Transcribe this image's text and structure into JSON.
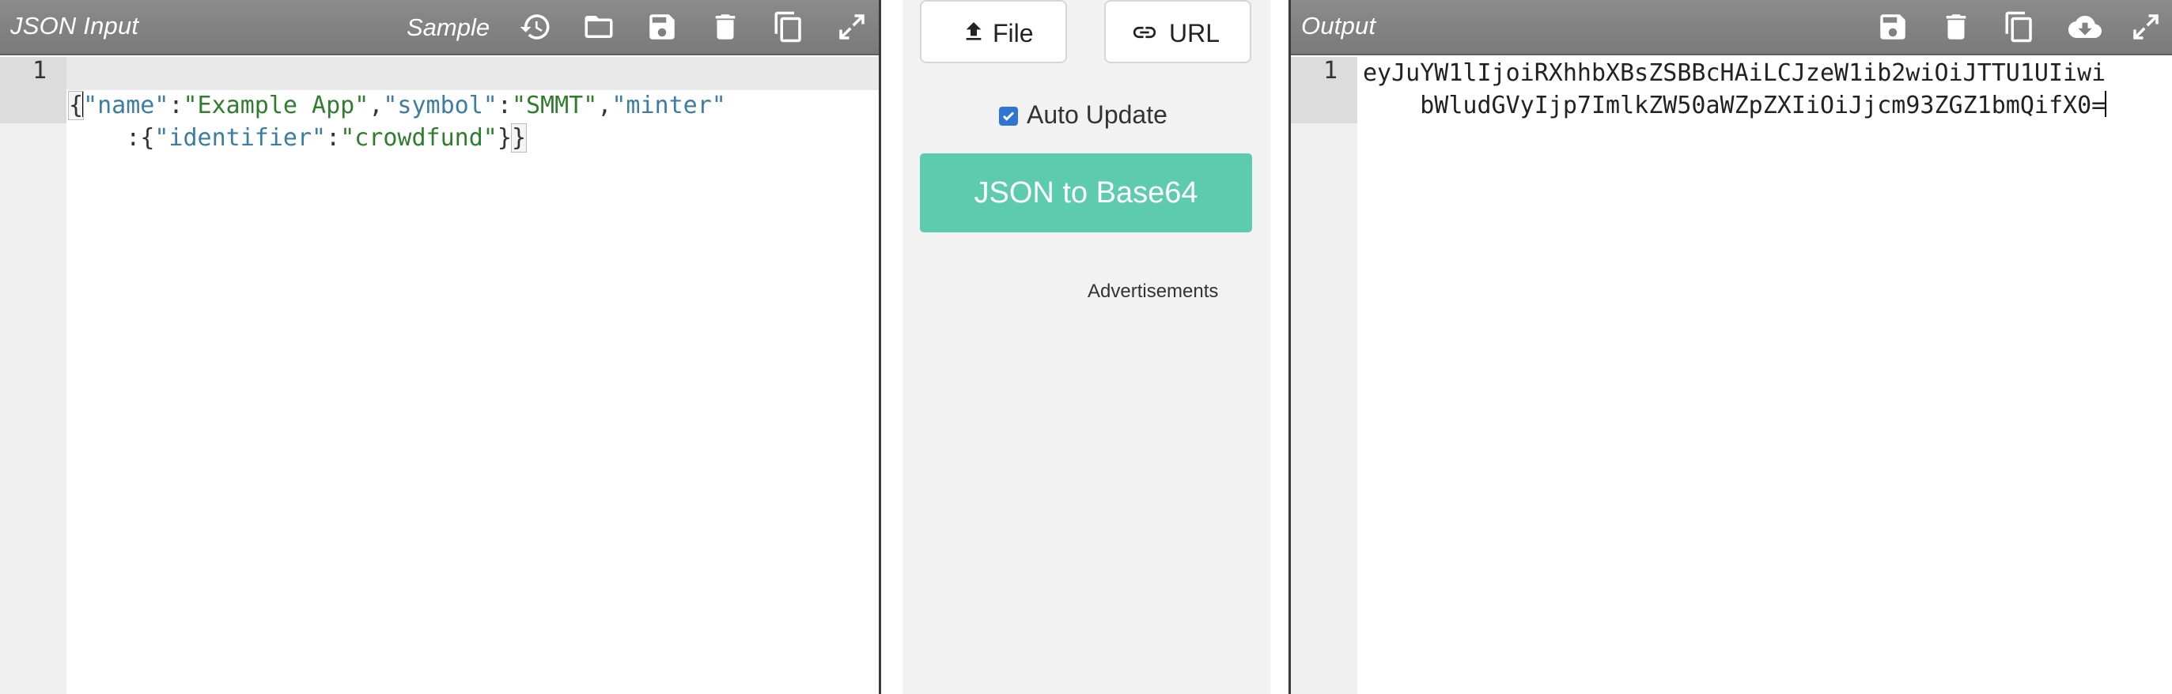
{
  "left": {
    "title": "JSON Input",
    "sample_label": "Sample",
    "icons": [
      "history-icon",
      "open-folder-icon",
      "save-icon",
      "delete-icon",
      "copy-icon",
      "fullscreen-icon"
    ],
    "line_number": "1",
    "code": {
      "l1_open": "{",
      "k_name": "\"name\"",
      "colon1": ":",
      "v_name": "\"Example App\"",
      "comma1": ",",
      "k_symbol": "\"symbol\"",
      "colon2": ":",
      "v_symbol": "\"SMMT\"",
      "comma2": ",",
      "k_minter": "\"minter\"",
      "colon3": ":",
      "open2": "{",
      "k_identifier": "\"identifier\"",
      "colon4": ":",
      "v_identifier": "\"crowdfund\"",
      "close2": "}",
      "close1": "}"
    }
  },
  "middle": {
    "file_button": "File",
    "url_button": "URL",
    "auto_update_label": "Auto Update",
    "auto_update_checked": true,
    "convert_button": "JSON to Base64",
    "ads_label": "Advertisements",
    "convert_color": "#5ccbae"
  },
  "right": {
    "title": "Output",
    "icons": [
      "save-icon",
      "delete-icon",
      "copy-icon",
      "download-cloud-icon",
      "fullscreen-icon"
    ],
    "line_number": "1",
    "output_line1": "eyJuYW1lIjoiRXhhbXBsZSBBcHAiLCJzeW1ib2wiOiJTTU1UIiwi",
    "output_line2": "bWludGVyIjp7ImlkZW50aWZpZXIiOiJjcm93ZGZ1bmQifX0="
  }
}
